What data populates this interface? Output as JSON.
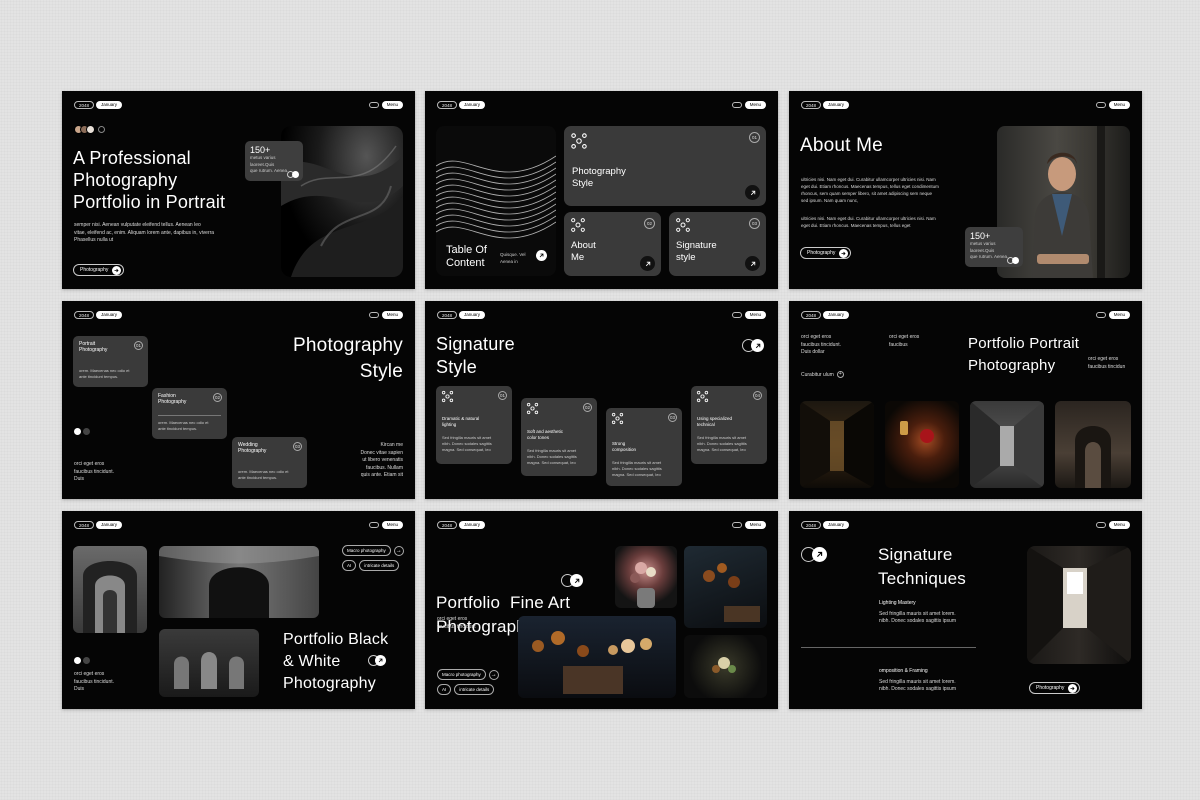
{
  "common": {
    "year": "2048",
    "month": "January",
    "menu": "Menu"
  },
  "s1": {
    "title_l1": "A Professional",
    "title_l2": "Photography",
    "title_l3": "Portfolio in Portrait",
    "body_l1": "semper nisi. Aenean vulputate eleifend tellus. Aenean leo",
    "body_l2": "vitae, eleifend ac, enim. Aliquam lorem ante, dapibus in, viverra",
    "body_l3": "Phasellus nulla ut",
    "stat": "150+",
    "stat_l1": "metus varius laoreet.Quis",
    "stat_l2": "que rutrum. Aenea.",
    "button": "Photography"
  },
  "s2": {
    "toc_l1": "Table Of",
    "toc_l2": "Content",
    "toc_small": "Quisque. Vel Aenea in",
    "c1_l1": "Photography",
    "c1_l2": "Style",
    "c1_num": "01",
    "c2_l1": "About",
    "c2_l2": "Me",
    "c2_num": "02",
    "c3_l1": "Signature",
    "c3_l2": "style",
    "c3_num": "03"
  },
  "s3": {
    "title": "About Me",
    "p1": "ultricies nisi. Nam eget dui. Curabitur ullamcorper ultricies nisi. Nam eget dui. Etiam rhoncus. Maecenas tempus, tellus eget condimentum rhoncus, sem quam semper libero, sit amet adipiscing sem neque sed ipsum. Nam quam nunc,",
    "p2": "ultricies nisi. Nam eget dui. Curabitur ullamcorper ultricies nisi. Nam eget dui. Etiam rhoncus. Maecenas tempus, tellus eget",
    "button": "Photography",
    "stat": "150+",
    "stat_l1": "metus varius laoreet.Quis",
    "stat_l2": "que rutrum. Aenea."
  },
  "s4": {
    "title_l1": "Photography",
    "title_l2": "Style",
    "c1_l1": "Portrait",
    "c1_l2": "Photography",
    "c1_num": "01",
    "c1_b1": "orem. Maecenas nec odio et",
    "c1_b2": "ante tincidunt tempus.",
    "c2_l1": "Fashion",
    "c2_l2": "Photography",
    "c2_num": "02",
    "c2_b1": "orem. Maecenas nec odio et",
    "c2_b2": "ante tincidunt tempus.",
    "c3_l1": "Wedding",
    "c3_l2": "Photography",
    "c3_num": "03",
    "c3_b1": "orem. Maecenas nec odio et",
    "c3_b2": "ante tincidunt tempus.",
    "left_l1": "orci eget eros",
    "left_l2": "faucibus tincidunt.",
    "left_l3": "Duis",
    "right_l1": "Kircan me",
    "right_l2": "Donec vitae sapien",
    "right_l3": "ut libero venenatis",
    "right_l4": "faucibus. Nullam",
    "right_l5": "quis ante. Etiam sit"
  },
  "s5": {
    "title_l1": "Signature",
    "title_l2": "Style",
    "c1_l1": "Dramatic & natural",
    "c1_l2": "lighting",
    "c1_num": "01",
    "c2_l1": "Soft and aesthetic",
    "c2_l2": "color tones",
    "c2_num": "02",
    "c3_l1": "Strong",
    "c3_l2": "composition",
    "c3_num": "03",
    "c4_l1": "Using specialized",
    "c4_l2": "technical",
    "c4_num": "04",
    "body_l1": "Sed fringilla mauris sit amet",
    "body_l2": "nibh. Donec sodales sagittis",
    "body_l3": "magna. Sed consequat, leo"
  },
  "s6": {
    "title_l1": "Portfolio Portrait",
    "title_l2": "Photography",
    "a_l1": "orci eget eros",
    "a_l2": "faucibus tincidunt.",
    "a_l3": "Duis dollar",
    "b_l1": "orci eget eros",
    "b_l2": "faucibus",
    "r_l1": "orci eget eros",
    "r_l2": "faucibus tincidun",
    "link": "Curabitur ulum"
  },
  "s7": {
    "title_l1": "Portfolio Black",
    "title_l2": "& White",
    "title_l3": "Photography",
    "tag1": "Macro photography",
    "tag2": "AI",
    "tag3": "intricate details",
    "left_l1": "orci eget eros",
    "left_l2": "faucibus tincidunt.",
    "left_l3": "Duis"
  },
  "s8": {
    "title_l1": "Portfolio  Fine Art",
    "title_l2": "Photography",
    "left_l1": "orci eget eros",
    "left_l2": "faucibus tincidunt",
    "tag1": "Macro photography",
    "tag2": "AI",
    "tag3": "intricate details"
  },
  "s9": {
    "title_l1": "Signature",
    "title_l2": "Techniques",
    "h1": "Lighting Mastery",
    "h1_b1": "Sed fringilla mauris sit amet lorem.",
    "h1_b2": "nibh. Donec sodales sagittis ipsum",
    "h2": "omposition & Framing",
    "h2_b1": "Sed fringilla mauris sit amet lorem.",
    "h2_b2": "nibh. Donec sodales sagittis ipsum",
    "button": "Photography"
  }
}
